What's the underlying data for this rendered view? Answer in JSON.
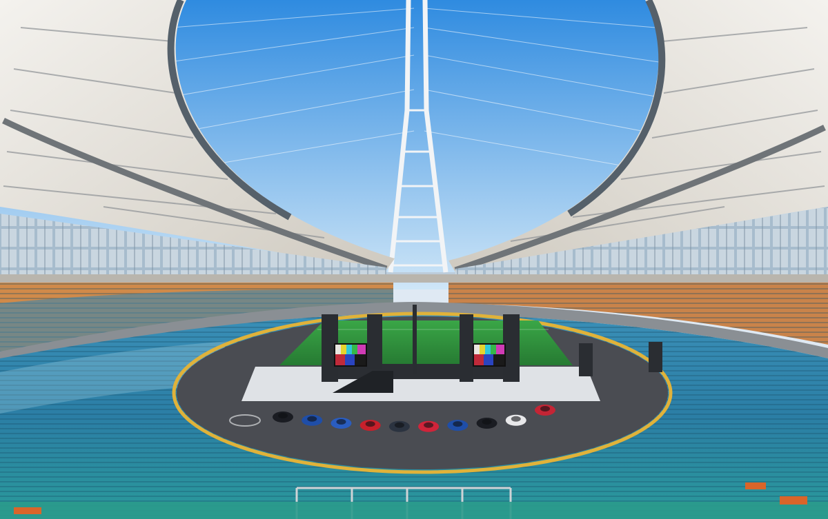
{
  "scene": {
    "subject": "stadium-interior",
    "colors": {
      "sky_top": "#2f8be0",
      "sky_bottom": "#cfe6f7",
      "roof_membrane": "#eceae4",
      "roof_truss": "#6f7478",
      "facade_glass": "#9fb6c9",
      "seats_blue": "#2f86b0",
      "seats_teal": "#2aa3a3",
      "seats_orange": "#d9652a",
      "track": "#4a4c52",
      "track_edge": "#e0b23a",
      "pitch": "#2f8f3c",
      "stage_floor": "#dfe2e6",
      "speaker": "#2a2d32"
    },
    "cars": [
      "#1a1c22",
      "#1f4ea8",
      "#2a5dc0",
      "#c8202b",
      "#2b3340",
      "#d0243a",
      "#1f4ea8",
      "#1a1c22",
      "#e8e8ea",
      "#c42535"
    ]
  }
}
